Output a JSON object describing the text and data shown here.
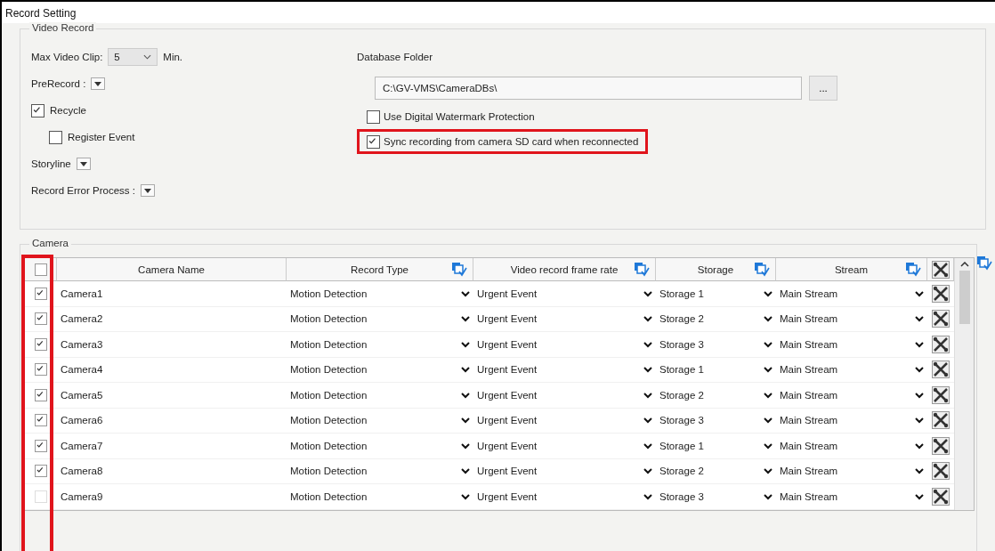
{
  "window": {
    "title": "Record Setting"
  },
  "video_record": {
    "title": "Video Record",
    "max_video_clip": {
      "label": "Max Video Clip:",
      "value": "5",
      "unit": "Min."
    },
    "prerecord": {
      "label": "PreRecord :"
    },
    "recycle": {
      "label": "Recycle",
      "checked": true
    },
    "register_event": {
      "label": "Register Event",
      "checked": false
    },
    "storyline": {
      "label": "Storyline"
    },
    "record_error_process": {
      "label": "Record Error Process :"
    },
    "database_folder": {
      "label": "Database Folder",
      "value": "C:\\GV-VMS\\CameraDBs\\",
      "browse": "..."
    },
    "options": [
      {
        "label": "Use Digital Watermark Protection",
        "checked": false,
        "highlighted": false
      },
      {
        "label": "Sync recording from camera SD card when reconnected",
        "checked": true,
        "highlighted": true
      }
    ]
  },
  "camera": {
    "title": "Camera",
    "select_all_checked": false,
    "checkbox_column_highlighted": true,
    "columns": [
      {
        "label": "Camera Name",
        "apply_all": false
      },
      {
        "label": "Record Type",
        "apply_all": true
      },
      {
        "label": "Video record frame rate",
        "apply_all": true
      },
      {
        "label": "Storage",
        "apply_all": true
      },
      {
        "label": "Stream",
        "apply_all": true
      }
    ],
    "rows": [
      {
        "checked": true,
        "name": "Camera1",
        "record_type": "Motion Detection",
        "frame_rate": "Urgent Event",
        "storage": "Storage 1",
        "stream": "Main Stream"
      },
      {
        "checked": true,
        "name": "Camera2",
        "record_type": "Motion Detection",
        "frame_rate": "Urgent Event",
        "storage": "Storage 2",
        "stream": "Main Stream"
      },
      {
        "checked": true,
        "name": "Camera3",
        "record_type": "Motion Detection",
        "frame_rate": "Urgent Event",
        "storage": "Storage 3",
        "stream": "Main Stream"
      },
      {
        "checked": true,
        "name": "Camera4",
        "record_type": "Motion Detection",
        "frame_rate": "Urgent Event",
        "storage": "Storage 1",
        "stream": "Main Stream"
      },
      {
        "checked": true,
        "name": "Camera5",
        "record_type": "Motion Detection",
        "frame_rate": "Urgent Event",
        "storage": "Storage 2",
        "stream": "Main Stream"
      },
      {
        "checked": true,
        "name": "Camera6",
        "record_type": "Motion Detection",
        "frame_rate": "Urgent Event",
        "storage": "Storage 3",
        "stream": "Main Stream"
      },
      {
        "checked": true,
        "name": "Camera7",
        "record_type": "Motion Detection",
        "frame_rate": "Urgent Event",
        "storage": "Storage 1",
        "stream": "Main Stream"
      },
      {
        "checked": true,
        "name": "Camera8",
        "record_type": "Motion Detection",
        "frame_rate": "Urgent Event",
        "storage": "Storage 2",
        "stream": "Main Stream"
      },
      {
        "checked": false,
        "name": "Camera9",
        "record_type": "Motion Detection",
        "frame_rate": "Urgent Event",
        "storage": "Storage 3",
        "stream": "Main Stream"
      }
    ]
  }
}
